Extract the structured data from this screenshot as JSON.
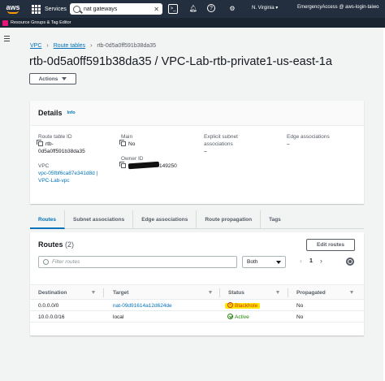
{
  "topbar": {
    "logo": "aws",
    "services_label": "Services",
    "search_value": "nat gateways",
    "region": "N. Virginia",
    "account": "EmergencyAccess @ aws-login-taiwo"
  },
  "subbar": {
    "label": "Resource Groups & Tag Editor"
  },
  "breadcrumb": {
    "items": [
      "VPC",
      "Route tables",
      "rtb-0d5a0ff591b38da35"
    ]
  },
  "page": {
    "title": "rtb-0d5a0ff591b38da35 / VPC-Lab-rtb-private1-us-east-1a",
    "actions_label": "Actions"
  },
  "details": {
    "heading": "Details",
    "info": "Info",
    "route_table_id_label": "Route table ID",
    "route_table_id_line1": "rtb-",
    "route_table_id_line2": "0d5a0ff591b38da35",
    "main_label": "Main",
    "main_value": "No",
    "explicit_label_line1": "Explicit subnet",
    "explicit_label_line2": "associations",
    "explicit_value": "–",
    "edge_label": "Edge associations",
    "edge_value": "–",
    "vpc_label": "VPC",
    "vpc_line1": "vpc-05fbf6ca87e341d8d |",
    "vpc_line2": "VPC-Lab-vpc",
    "owner_label": "Owner ID",
    "owner_value_visible": "149250"
  },
  "tabs": [
    {
      "label": "Routes",
      "active": true
    },
    {
      "label": "Subnet associations",
      "active": false
    },
    {
      "label": "Edge associations",
      "active": false
    },
    {
      "label": "Route propagation",
      "active": false
    },
    {
      "label": "Tags",
      "active": false
    }
  ],
  "routes": {
    "title": "Routes",
    "count": "(2)",
    "edit_label": "Edit routes",
    "filter_placeholder": "Filter routes",
    "select_value": "Both",
    "page": "1",
    "columns": [
      "Destination",
      "Target",
      "Status",
      "Propagated"
    ],
    "rows": [
      {
        "destination": "0.0.0.0/0",
        "target": "nat-09d91614a12d624de",
        "status": "Blackhole",
        "propagated": "No"
      },
      {
        "destination": "10.0.0.0/16",
        "target": "local",
        "status": "Active",
        "propagated": "No"
      }
    ]
  },
  "colors": {
    "topbar": "#232f3e",
    "link": "#0073bb",
    "blackhole_highlight": "#ffe600",
    "error": "#d13212",
    "success": "#1d8102"
  }
}
